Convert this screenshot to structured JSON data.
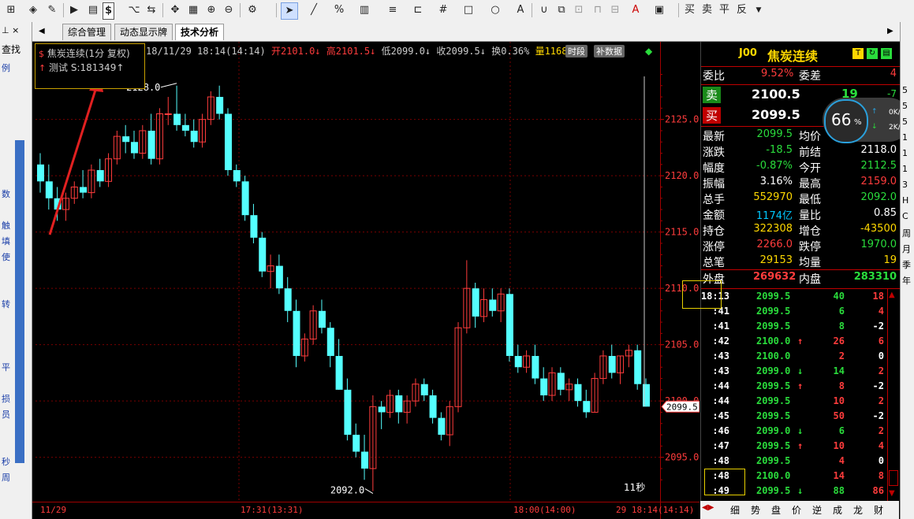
{
  "toolbar": {
    "dollar_label": "$",
    "buttons": [
      "买",
      "卖",
      "平",
      "反"
    ]
  },
  "left_panel": {
    "header": "查找",
    "items": [
      "例",
      "数",
      "触",
      "填",
      "使",
      "转",
      "平",
      "损",
      "员",
      "秒",
      "周"
    ]
  },
  "tabs": [
    {
      "label": "综合管理"
    },
    {
      "label": "动态显示牌"
    },
    {
      "label": "技术分析"
    }
  ],
  "infobar": {
    "symbol": "焦炭连续(1分 复权)",
    "datetime": "18/11/29 18:14(14:14)",
    "open": "开2101.0↓",
    "high": "高2101.5↓",
    "low": "低2099.0↓",
    "close": "收2099.5↓",
    "turnover": "换0.36%",
    "volume": "量1168",
    "btn_shiduan": "时段",
    "btn_buhsu": "补数据"
  },
  "legend": {
    "line1": "焦炭连续(1分 复权)",
    "line2": "测试 S:181349↑"
  },
  "chart_data": {
    "type": "candlestick",
    "ylim": [
      2092,
      2130
    ],
    "yticks": [
      "2125.0",
      "2120.0",
      "2115.0",
      "2110.0",
      "2105.0",
      "2100.0",
      "2095.0"
    ],
    "xticks": [
      "11/29",
      "17:31(13:31)",
      "18:00(14:00)",
      "29 18:14(14:14)"
    ],
    "annotations": {
      "high_label": "2128.0",
      "low_label": "2092.0",
      "last_price": "2099.5",
      "countdown": "11秒"
    },
    "candles": [
      [
        2121,
        2122,
        2118.5,
        2119.5
      ],
      [
        2119.5,
        2121,
        2117,
        2118
      ],
      [
        2118,
        2119,
        2116,
        2117
      ],
      [
        2117,
        2118.5,
        2116,
        2118
      ],
      [
        2118,
        2119.5,
        2117.5,
        2119
      ],
      [
        2119,
        2120.5,
        2118,
        2118.5
      ],
      [
        2118.5,
        2121,
        2118,
        2120.5
      ],
      [
        2120.5,
        2121.5,
        2119,
        2119.5
      ],
      [
        2119.5,
        2122,
        2119,
        2121.5
      ],
      [
        2121.5,
        2124,
        2121,
        2123.5
      ],
      [
        2123.5,
        2124.5,
        2122,
        2123
      ],
      [
        2123,
        2124,
        2121.5,
        2122
      ],
      [
        2122,
        2124.5,
        2121.5,
        2124
      ],
      [
        2124,
        2125.5,
        2121,
        2121.5
      ],
      [
        2121.5,
        2126,
        2121,
        2125.5
      ],
      [
        2125.5,
        2127,
        2124.5,
        2125.5
      ],
      [
        2125.5,
        2128,
        2124,
        2124.5
      ],
      [
        2124.5,
        2125.5,
        2123.5,
        2124
      ],
      [
        2124,
        2125,
        2122.5,
        2123
      ],
      [
        2123,
        2125.5,
        2122.5,
        2125
      ],
      [
        2125,
        2127.5,
        2124.5,
        2127
      ],
      [
        2127,
        2128,
        2125,
        2125.5
      ],
      [
        2125.5,
        2126,
        2120,
        2120.5
      ],
      [
        2120.5,
        2121,
        2119,
        2119.5
      ],
      [
        2119.5,
        2120,
        2116,
        2116.5
      ],
      [
        2116.5,
        2117.5,
        2114,
        2114.5
      ],
      [
        2114.5,
        2115,
        2111,
        2111.5
      ],
      [
        2111.5,
        2113,
        2110,
        2112
      ],
      [
        2112,
        2113,
        2109.5,
        2110
      ],
      [
        2110,
        2111,
        2107,
        2108
      ],
      [
        2108,
        2109,
        2103,
        2104
      ],
      [
        2104,
        2106,
        2103.5,
        2105.5
      ],
      [
        2105.5,
        2108.5,
        2105,
        2108
      ],
      [
        2108,
        2109,
        2106,
        2106.5
      ],
      [
        2106.5,
        2107,
        2103,
        2104
      ],
      [
        2104,
        2105.5,
        2101,
        2101
      ],
      [
        2101,
        2102,
        2096.5,
        2097
      ],
      [
        2097,
        2098,
        2095,
        2095.5
      ],
      [
        2095.5,
        2097,
        2093,
        2094
      ],
      [
        2094,
        2100.5,
        2092,
        2099.5
      ],
      [
        2099.5,
        2100,
        2097.5,
        2099
      ],
      [
        2099,
        2101,
        2098.5,
        2100.5
      ],
      [
        2100.5,
        2101,
        2098,
        2099
      ],
      [
        2099,
        2100.5,
        2098,
        2100
      ],
      [
        2100,
        2102,
        2099.5,
        2101.5
      ],
      [
        2101.5,
        2102,
        2100,
        2100.5
      ],
      [
        2100.5,
        2101,
        2098,
        2098.5
      ],
      [
        2098.5,
        2099,
        2096.5,
        2097
      ],
      [
        2097,
        2100,
        2096,
        2099.5
      ],
      [
        2099.5,
        2107,
        2099,
        2106.5
      ],
      [
        2106.5,
        2112.5,
        2106,
        2110
      ],
      [
        2110,
        2110.5,
        2106.5,
        2107.5
      ],
      [
        2107.5,
        2110,
        2107,
        2109
      ],
      [
        2109,
        2110,
        2107.5,
        2108
      ],
      [
        2108,
        2110,
        2107,
        2109.5
      ],
      [
        2109.5,
        2110,
        2103.5,
        2104
      ],
      [
        2104,
        2105,
        2102.5,
        2103
      ],
      [
        2103,
        2104.5,
        2102.5,
        2104
      ],
      [
        2104,
        2105,
        2101.5,
        2102
      ],
      [
        2102,
        2103,
        2100,
        2100.5
      ],
      [
        2100.5,
        2103,
        2100,
        2102.5
      ],
      [
        2102.5,
        2103,
        2100.5,
        2101
      ],
      [
        2101,
        2102,
        2100,
        2101.5
      ],
      [
        2101.5,
        2102,
        2099.5,
        2100
      ],
      [
        2100,
        2101,
        2098.5,
        2099
      ],
      [
        2099,
        2102.5,
        2099,
        2102
      ],
      [
        2102,
        2104.5,
        2101.5,
        2104
      ],
      [
        2104,
        2105,
        2102,
        2102.5
      ],
      [
        2102.5,
        2104,
        2101.5,
        2104
      ],
      [
        2104,
        2105,
        2103,
        2104.5
      ],
      [
        2104.5,
        2105,
        2101,
        2101.5
      ],
      [
        2101.5,
        2102,
        2099.5,
        2099.5
      ]
    ]
  },
  "right_panel": {
    "code": "J00",
    "name": "焦炭连续",
    "weibi_label": "委比",
    "weibi_val": "9.52%",
    "weicha_label": "委差",
    "weicha_val": "4",
    "sell_label": "卖",
    "sell_price": "2100.5",
    "sell_vol": "19",
    "sell_chg": "-7",
    "buy_label": "买",
    "buy_price": "2099.5",
    "quote_rows": [
      {
        "l1": "最新",
        "v1": "2099.5",
        "l2": "均价",
        "v2": "",
        "c1": "#2adc3c",
        "c2": "#ffffff"
      },
      {
        "l1": "涨跌",
        "v1": "-18.5",
        "l2": "前结",
        "v2": "2118.0",
        "c1": "#2adc3c",
        "c2": "#ffffff"
      },
      {
        "l1": "幅度",
        "v1": "-0.87%",
        "l2": "今开",
        "v2": "2112.5",
        "c1": "#2adc3c",
        "c2": "#2adc3c"
      },
      {
        "l1": "振幅",
        "v1": "3.16%",
        "l2": "最高",
        "v2": "2159.0",
        "c1": "#ffffff",
        "c2": "#ff3c3c"
      },
      {
        "l1": "总手",
        "v1": "552970",
        "l2": "最低",
        "v2": "2092.0",
        "c1": "#ffd800",
        "c2": "#2adc3c"
      },
      {
        "l1": "金额",
        "v1": "1174亿",
        "l2": "量比",
        "v2": "0.85",
        "c1": "#00c8ff",
        "c2": "#ffffff"
      },
      {
        "l1": "持仓",
        "v1": "322308",
        "l2": "增仓",
        "v2": "-43500",
        "c1": "#ffd800",
        "c2": "#ffd800"
      },
      {
        "l1": "涨停",
        "v1": "2266.0",
        "l2": "跌停",
        "v2": "1970.0",
        "c1": "#ff3c3c",
        "c2": "#2adc3c"
      },
      {
        "l1": "总笔",
        "v1": "29153",
        "l2": "均量",
        "v2": "19",
        "c1": "#ffd800",
        "c2": "#ffd800"
      }
    ],
    "outer_label": "外盘",
    "outer_val": "269632",
    "inner_label": "内盘",
    "inner_val": "283310",
    "trades": [
      {
        "t": "18:13",
        "p": "2099.5",
        "arrow": "",
        "v": "40",
        "d": "18",
        "pc": "#2adc3c",
        "vc": "#2adc3c",
        "dc": "#ff3c3c",
        "ac": "#ff3c3c"
      },
      {
        "t": ":41",
        "p": "2099.5",
        "arrow": "",
        "v": "6",
        "d": "4",
        "pc": "#2adc3c",
        "vc": "#2adc3c",
        "dc": "#ff3c3c",
        "ac": "#ff3c3c"
      },
      {
        "t": ":41",
        "p": "2099.5",
        "arrow": "",
        "v": "8",
        "d": "-2",
        "pc": "#2adc3c",
        "vc": "#2adc3c",
        "dc": "#ffffff",
        "ac": "#ff3c3c"
      },
      {
        "t": ":42",
        "p": "2100.0",
        "arrow": "↑",
        "v": "26",
        "d": "6",
        "pc": "#2adc3c",
        "vc": "#ff3c3c",
        "dc": "#ff3c3c",
        "ac": "#ff3c3c"
      },
      {
        "t": ":43",
        "p": "2100.0",
        "arrow": "",
        "v": "2",
        "d": "0",
        "pc": "#2adc3c",
        "vc": "#ff3c3c",
        "dc": "#ffffff",
        "ac": "#ff3c3c"
      },
      {
        "t": ":43",
        "p": "2099.0",
        "arrow": "↓",
        "v": "14",
        "d": "2",
        "pc": "#2adc3c",
        "vc": "#2adc3c",
        "dc": "#ff3c3c",
        "ac": "#2adc3c"
      },
      {
        "t": ":44",
        "p": "2099.5",
        "arrow": "↑",
        "v": "8",
        "d": "-2",
        "pc": "#2adc3c",
        "vc": "#ff3c3c",
        "dc": "#ffffff",
        "ac": "#ff3c3c"
      },
      {
        "t": ":44",
        "p": "2099.5",
        "arrow": "",
        "v": "10",
        "d": "2",
        "pc": "#2adc3c",
        "vc": "#ff3c3c",
        "dc": "#ff3c3c",
        "ac": "#ff3c3c"
      },
      {
        "t": ":45",
        "p": "2099.5",
        "arrow": "",
        "v": "50",
        "d": "-2",
        "pc": "#2adc3c",
        "vc": "#ff3c3c",
        "dc": "#ffffff",
        "ac": "#ff3c3c"
      },
      {
        "t": ":46",
        "p": "2099.0",
        "arrow": "↓",
        "v": "6",
        "d": "2",
        "pc": "#2adc3c",
        "vc": "#2adc3c",
        "dc": "#ff3c3c",
        "ac": "#2adc3c"
      },
      {
        "t": ":47",
        "p": "2099.5",
        "arrow": "↑",
        "v": "10",
        "d": "4",
        "pc": "#2adc3c",
        "vc": "#ff3c3c",
        "dc": "#ff3c3c",
        "ac": "#ff3c3c"
      },
      {
        "t": ":48",
        "p": "2099.5",
        "arrow": "",
        "v": "4",
        "d": "0",
        "pc": "#2adc3c",
        "vc": "#ff3c3c",
        "dc": "#ffffff",
        "ac": "#ff3c3c"
      },
      {
        "t": ":48",
        "p": "2100.0",
        "arrow": "",
        "v": "14",
        "d": "8",
        "pc": "#2adc3c",
        "vc": "#ff3c3c",
        "dc": "#ff3c3c",
        "ac": "#ff3c3c"
      },
      {
        "t": ":49",
        "p": "2099.5",
        "arrow": "↓",
        "v": "88",
        "d": "86",
        "pc": "#2adc3c",
        "vc": "#2adc3c",
        "dc": "#ff3c3c",
        "ac": "#2adc3c"
      }
    ],
    "bottom_tabs": [
      "细",
      "势",
      "盘",
      "价",
      "逆",
      "成",
      "龙",
      "财"
    ]
  },
  "net_widget": {
    "percent": "66",
    "percent_sign": "%",
    "up": "0K/s",
    "down": "2K/s"
  },
  "far_right": {
    "items": [
      "5",
      "5",
      "5",
      "1",
      "1",
      "1",
      "3",
      "H",
      "C",
      "周",
      "月",
      "季",
      "年"
    ]
  }
}
